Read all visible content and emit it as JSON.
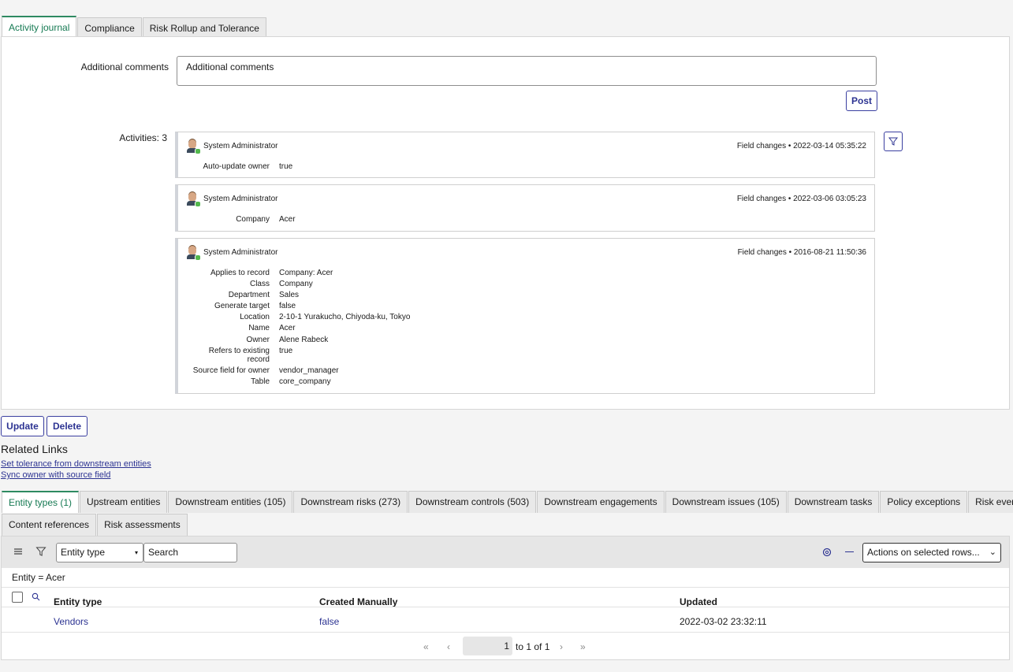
{
  "top_tabs": [
    "Activity journal",
    "Compliance",
    "Risk Rollup and Tolerance"
  ],
  "comments": {
    "label": "Additional comments",
    "placeholder": "Additional comments",
    "post": "Post"
  },
  "activities": {
    "label": "Activities: 3",
    "items": [
      {
        "user": "System Administrator",
        "meta": "Field changes  •  2022-03-14 05:35:22",
        "fields": [
          {
            "k": "Auto-update owner",
            "v": "true"
          }
        ]
      },
      {
        "user": "System Administrator",
        "meta": "Field changes  •  2022-03-06 03:05:23",
        "fields": [
          {
            "k": "Company",
            "v": "Acer"
          }
        ]
      },
      {
        "user": "System Administrator",
        "meta": "Field changes  •  2016-08-21 11:50:36",
        "fields": [
          {
            "k": "Applies to record",
            "v": "Company: Acer"
          },
          {
            "k": "Class",
            "v": "Company"
          },
          {
            "k": "Department",
            "v": "Sales"
          },
          {
            "k": "Generate target",
            "v": "false"
          },
          {
            "k": "Location",
            "v": "2-10-1 Yurakucho, Chiyoda-ku, Tokyo"
          },
          {
            "k": "Name",
            "v": "Acer"
          },
          {
            "k": "Owner",
            "v": "Alene Rabeck"
          },
          {
            "k": "Refers to existing record",
            "v": "true"
          },
          {
            "k": "Source field for owner",
            "v": "vendor_manager"
          },
          {
            "k": "Table",
            "v": "core_company"
          }
        ]
      }
    ]
  },
  "buttons": {
    "update": "Update",
    "delete": "Delete"
  },
  "related_links": {
    "title": "Related Links",
    "links": [
      "Set tolerance from downstream entities",
      "Sync owner with source field"
    ]
  },
  "related_tabs": [
    "Entity types (1)",
    "Upstream entities",
    "Downstream entities (105)",
    "Downstream risks (273)",
    "Downstream controls (503)",
    "Downstream engagements",
    "Downstream issues (105)",
    "Downstream tasks",
    "Policy exceptions",
    "Risk events",
    "Content references",
    "Risk assessments"
  ],
  "list": {
    "field_select": "Entity type",
    "search_placeholder": "Search",
    "actions": "Actions on selected rows...",
    "breadcrumb": "Entity = Acer",
    "columns": [
      "Entity type",
      "Created Manually",
      "Updated"
    ],
    "rows": [
      [
        "Vendors",
        "false",
        "2022-03-02 23:32:11"
      ]
    ],
    "page_current": "1",
    "page_info": "to 1 of 1"
  }
}
